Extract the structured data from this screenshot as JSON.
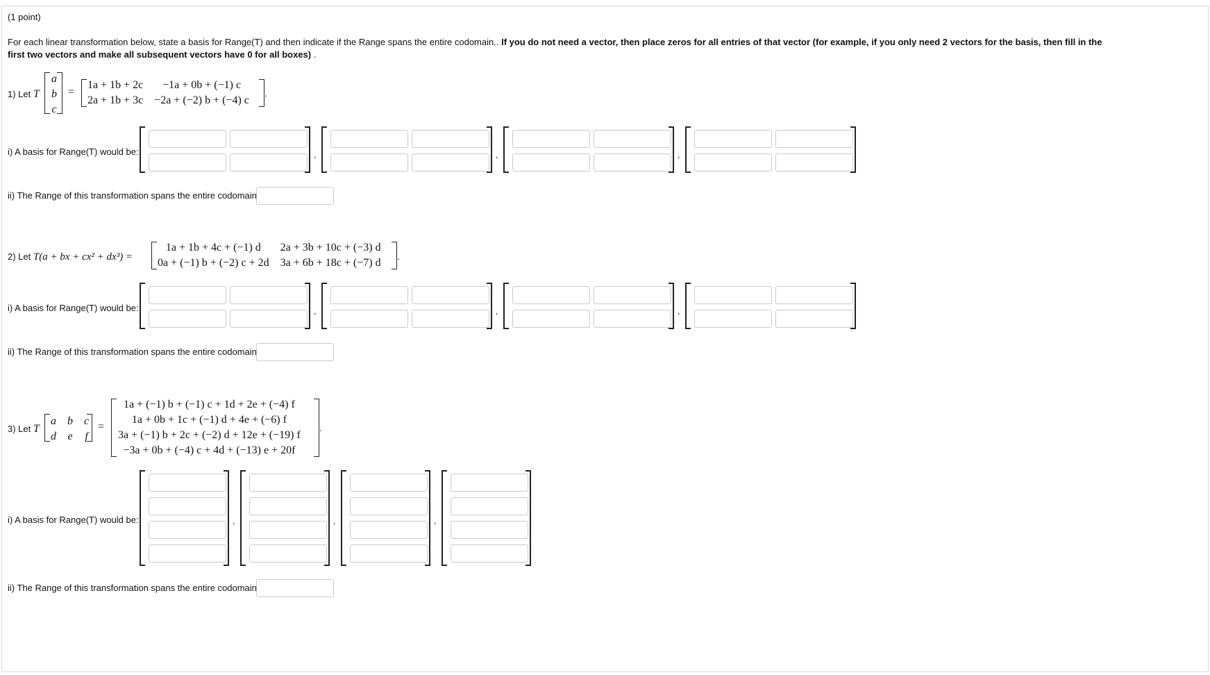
{
  "header": {
    "points": "(1 point)"
  },
  "instructions": {
    "intro": "For each linear transformation below, state a basis for Range(T) and then indicate if the Range spans the entire codomain.. ",
    "bold": "If you do not need a vector, then place zeros for all entries of that vector (for example, if you only need 2 vectors for the basis, then fill in the",
    "bold2": "first two vectors and make all subsequent vectors have 0 for all boxes)",
    "tail": " ."
  },
  "problems": [
    {
      "label": "1) Let ",
      "T": "T",
      "input_vector": [
        "a",
        "b",
        "c"
      ],
      "equals": "=",
      "output_matrix": [
        [
          "1a + 1b + 2c",
          "−1a + 0b + (−1) c"
        ],
        [
          "2a + 1b + 3c",
          "−2a + (−2) b + (−4) c"
        ]
      ],
      "basis_label": "i) A basis for Range(T) would be:",
      "span_label": "ii) The Range of this transformation spans the entire codomain:",
      "span_value": ""
    },
    {
      "label": "2) Let ",
      "lhs": "T(a + bx + cx² + dx³) =",
      "output_matrix": [
        [
          "1a + 1b + 4c + (−1) d",
          "2a + 3b + 10c + (−3) d"
        ],
        [
          "0a + (−1) b + (−2) c + 2d",
          "3a + 6b + 18c + (−7) d"
        ]
      ],
      "basis_label": "i) A basis for Range(T) would be:",
      "span_label": "ii) The Range of this transformation spans the entire codomain:",
      "span_value": ""
    },
    {
      "label": "3) Let ",
      "T": "T",
      "input_matrix": [
        [
          "a",
          "b",
          "c"
        ],
        [
          "d",
          "e",
          "f"
        ]
      ],
      "equals": "=",
      "output_vector": [
        "1a + (−1) b + (−1) c + 1d + 2e + (−4) f",
        "1a + 0b + 1c + (−1) d + 4e + (−6) f",
        "3a + (−1) b + 2c + (−2) d + 12e + (−19) f",
        "−3a + 0b + (−4) c + 4d + (−13) e + 20f"
      ],
      "basis_label": "i) A basis for Range(T) would be:",
      "span_label": "ii) The Range of this transformation spans the entire codomain:",
      "span_value": ""
    }
  ],
  "separators": {
    "comma": ",",
    "period": "."
  }
}
